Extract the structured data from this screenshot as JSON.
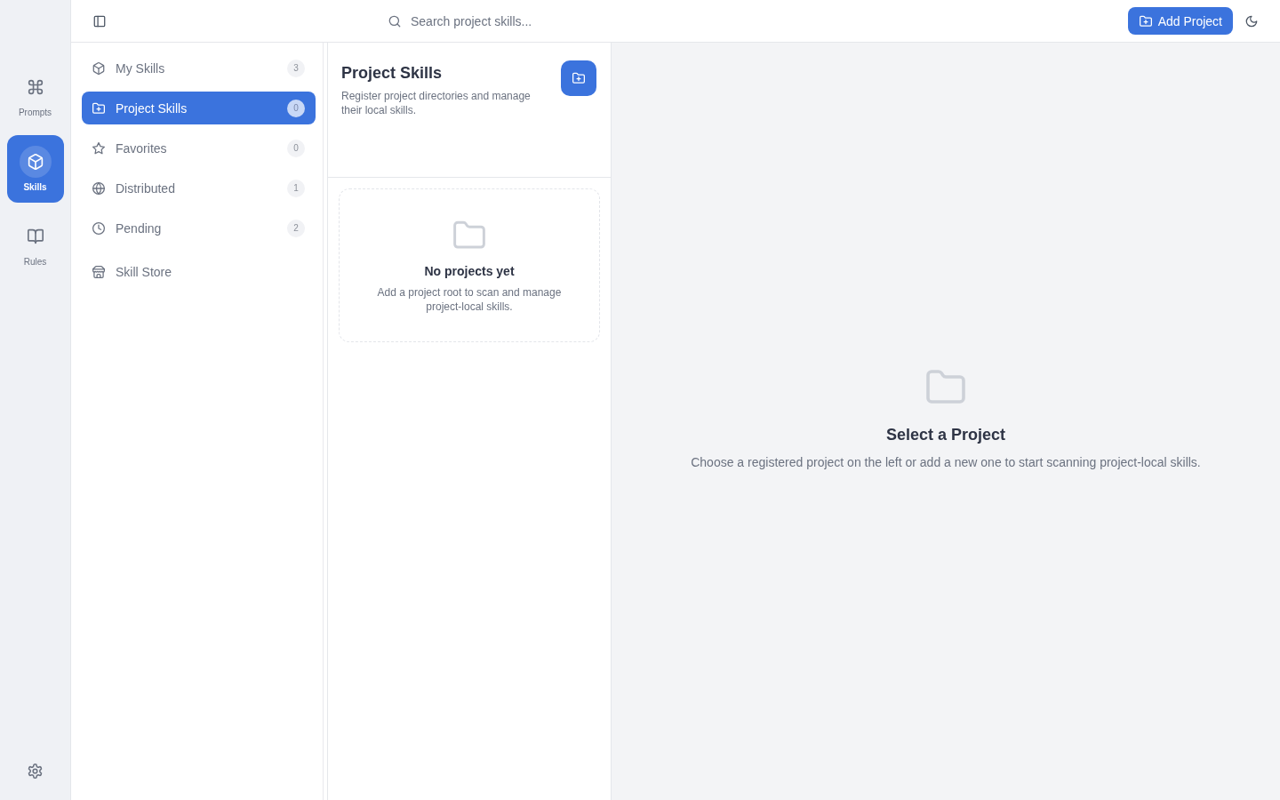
{
  "rail": {
    "items": [
      {
        "label": "Prompts",
        "selected": false
      },
      {
        "label": "Skills",
        "selected": true
      },
      {
        "label": "Rules",
        "selected": false
      }
    ]
  },
  "topbar": {
    "search": {
      "placeholder": "Search project skills..."
    },
    "add_button": "Add Project"
  },
  "sidebar": {
    "items": [
      {
        "label": "My Skills",
        "count": "3",
        "selected": false
      },
      {
        "label": "Project Skills",
        "count": "0",
        "selected": true
      },
      {
        "label": "Favorites",
        "count": "0",
        "selected": false
      },
      {
        "label": "Distributed",
        "count": "1",
        "selected": false
      },
      {
        "label": "Pending",
        "count": "2",
        "selected": false
      },
      {
        "label": "Skill Store",
        "selected": false
      }
    ]
  },
  "project_panel": {
    "title": "Project Skills",
    "description": "Register project directories and manage their local skills.",
    "empty_state": {
      "title": "No projects yet",
      "description": "Add a project root to scan and manage project-local skills."
    }
  },
  "detail": {
    "empty_state": {
      "title": "Select a Project",
      "description": "Choose a registered project on the left or add a new one to start scanning project-local skills."
    }
  }
}
